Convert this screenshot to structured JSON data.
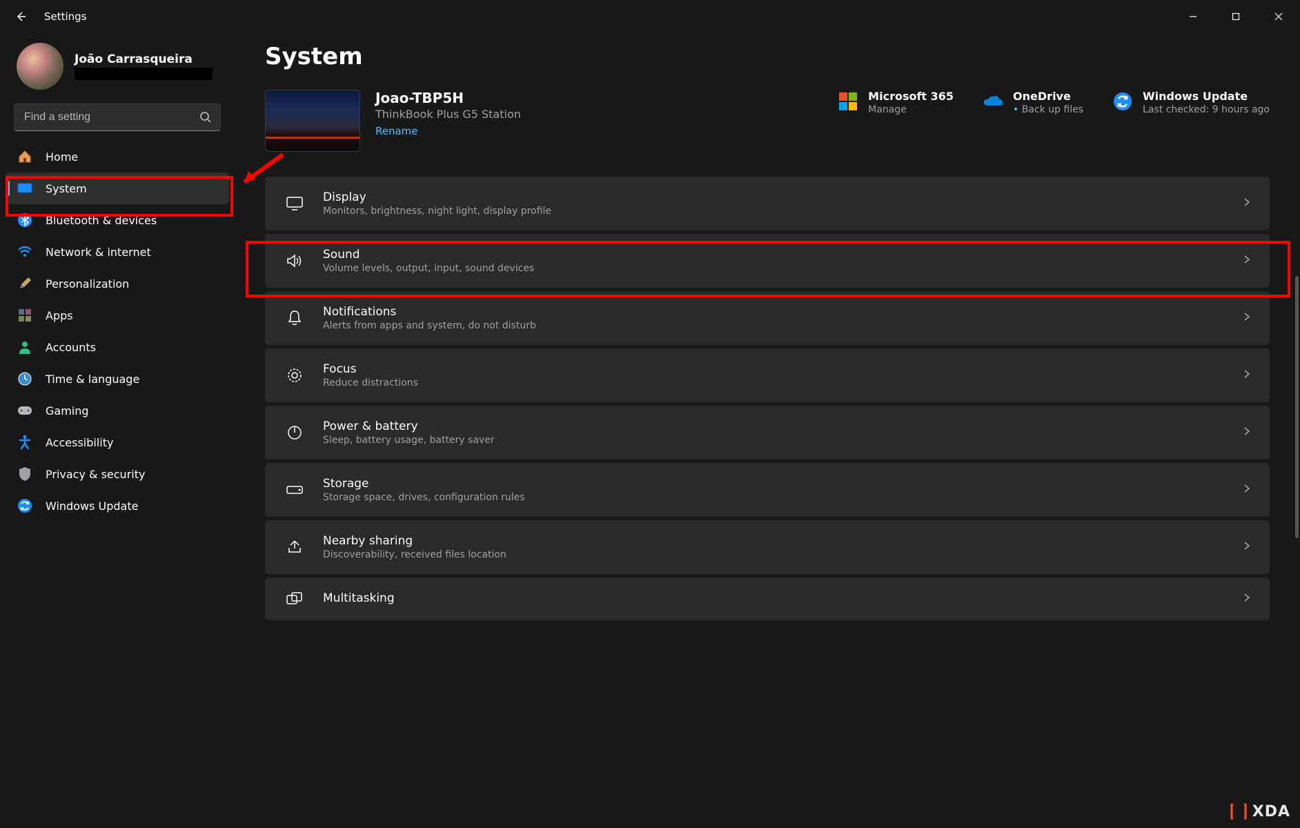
{
  "window": {
    "app_title": "Settings"
  },
  "user": {
    "name": "João Carrasqueira"
  },
  "search": {
    "placeholder": "Find a setting"
  },
  "sidebar": {
    "items": [
      {
        "label": "Home",
        "icon": "🏠"
      },
      {
        "label": "System",
        "icon": "🖥"
      },
      {
        "label": "Bluetooth & devices",
        "icon": "bt"
      },
      {
        "label": "Network & internet",
        "icon": "📶"
      },
      {
        "label": "Personalization",
        "icon": "🖌"
      },
      {
        "label": "Apps",
        "icon": "▦"
      },
      {
        "label": "Accounts",
        "icon": "👤"
      },
      {
        "label": "Time & language",
        "icon": "🕑"
      },
      {
        "label": "Gaming",
        "icon": "🎮"
      },
      {
        "label": "Accessibility",
        "icon": "acc"
      },
      {
        "label": "Privacy & security",
        "icon": "🛡"
      },
      {
        "label": "Windows Update",
        "icon": "🔄"
      }
    ]
  },
  "page": {
    "title": "System"
  },
  "device": {
    "name": "Joao-TBP5H",
    "model": "ThinkBook Plus G5 Station",
    "rename": "Rename"
  },
  "quick_links": [
    {
      "title": "Microsoft 365",
      "sub": "Manage",
      "bullet": false
    },
    {
      "title": "OneDrive",
      "sub": "Back up files",
      "bullet": true
    },
    {
      "title": "Windows Update",
      "sub": "Last checked: 9 hours ago",
      "bullet": false
    }
  ],
  "cards": [
    {
      "title": "Display",
      "sub": "Monitors, brightness, night light, display profile"
    },
    {
      "title": "Sound",
      "sub": "Volume levels, output, input, sound devices"
    },
    {
      "title": "Notifications",
      "sub": "Alerts from apps and system, do not disturb"
    },
    {
      "title": "Focus",
      "sub": "Reduce distractions"
    },
    {
      "title": "Power & battery",
      "sub": "Sleep, battery usage, battery saver"
    },
    {
      "title": "Storage",
      "sub": "Storage space, drives, configuration rules"
    },
    {
      "title": "Nearby sharing",
      "sub": "Discoverability, received files location"
    },
    {
      "title": "Multitasking",
      "sub": ""
    }
  ],
  "watermark": "XDA"
}
